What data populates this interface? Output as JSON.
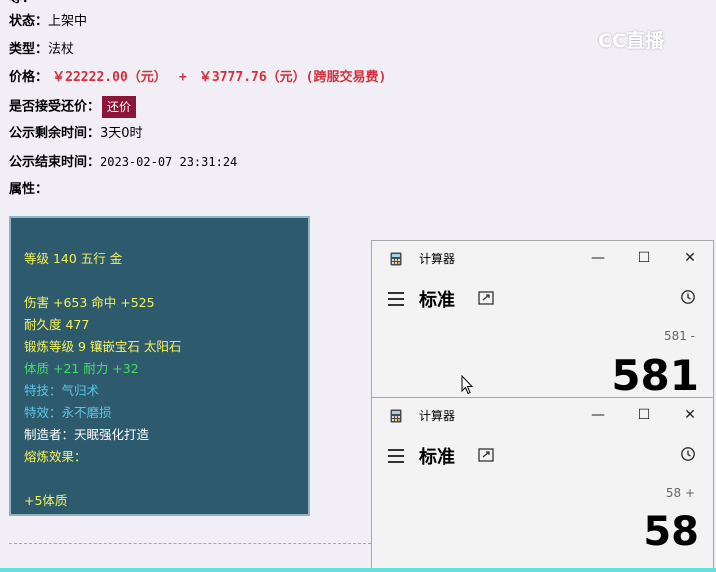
{
  "listing": {
    "status_label": "状态：",
    "status_value": "上架中",
    "type_label": "类型：",
    "type_value": "法杖",
    "price_label": "价格：",
    "price_main": "￥22222.00（元）",
    "price_plus": "+",
    "price_fee": "￥3777.76（元）(跨服交易费)",
    "bargain_label": "是否接受还价：",
    "bargain_button": "还价",
    "remaining_label": "公示剩余时间：",
    "remaining_value": "3天0时",
    "end_label": "公示结束时间：",
    "end_value": "2023-02-07 23:31:24",
    "attr_label": "属性："
  },
  "watermark": "CC直播",
  "attributes": {
    "level_line": "等级 140 五行 金",
    "damage_line": "伤害 +653 命中 +525",
    "durability_line": "耐久度 477",
    "forge_line": "锻炼等级 9 镶嵌宝石 太阳石",
    "bonus_line": "体质 +21 耐力 +32",
    "skill_line": "特技：气归术",
    "effect_line": "特效：永不磨损",
    "maker_line": "制造者：天眠强化打造",
    "smelt_line": "熔炼效果：",
    "smelt_value": "+5体质"
  },
  "calculators": [
    {
      "title": "计算器",
      "mode": "标准",
      "expression": "581 -",
      "display": "581",
      "minimize": "—",
      "maximize": "☐",
      "close": "✕"
    },
    {
      "title": "计算器",
      "mode": "标准",
      "expression": "58 +",
      "display": "58",
      "minimize": "—",
      "maximize": "☐",
      "close": "✕"
    }
  ],
  "colors": {
    "price": "#d3303c",
    "button": "#8b1538",
    "attr_bg": "#2e5a6e",
    "attr_yellow": "#f4f25a",
    "attr_green": "#3fe05f",
    "attr_blue": "#5cc5e6"
  }
}
